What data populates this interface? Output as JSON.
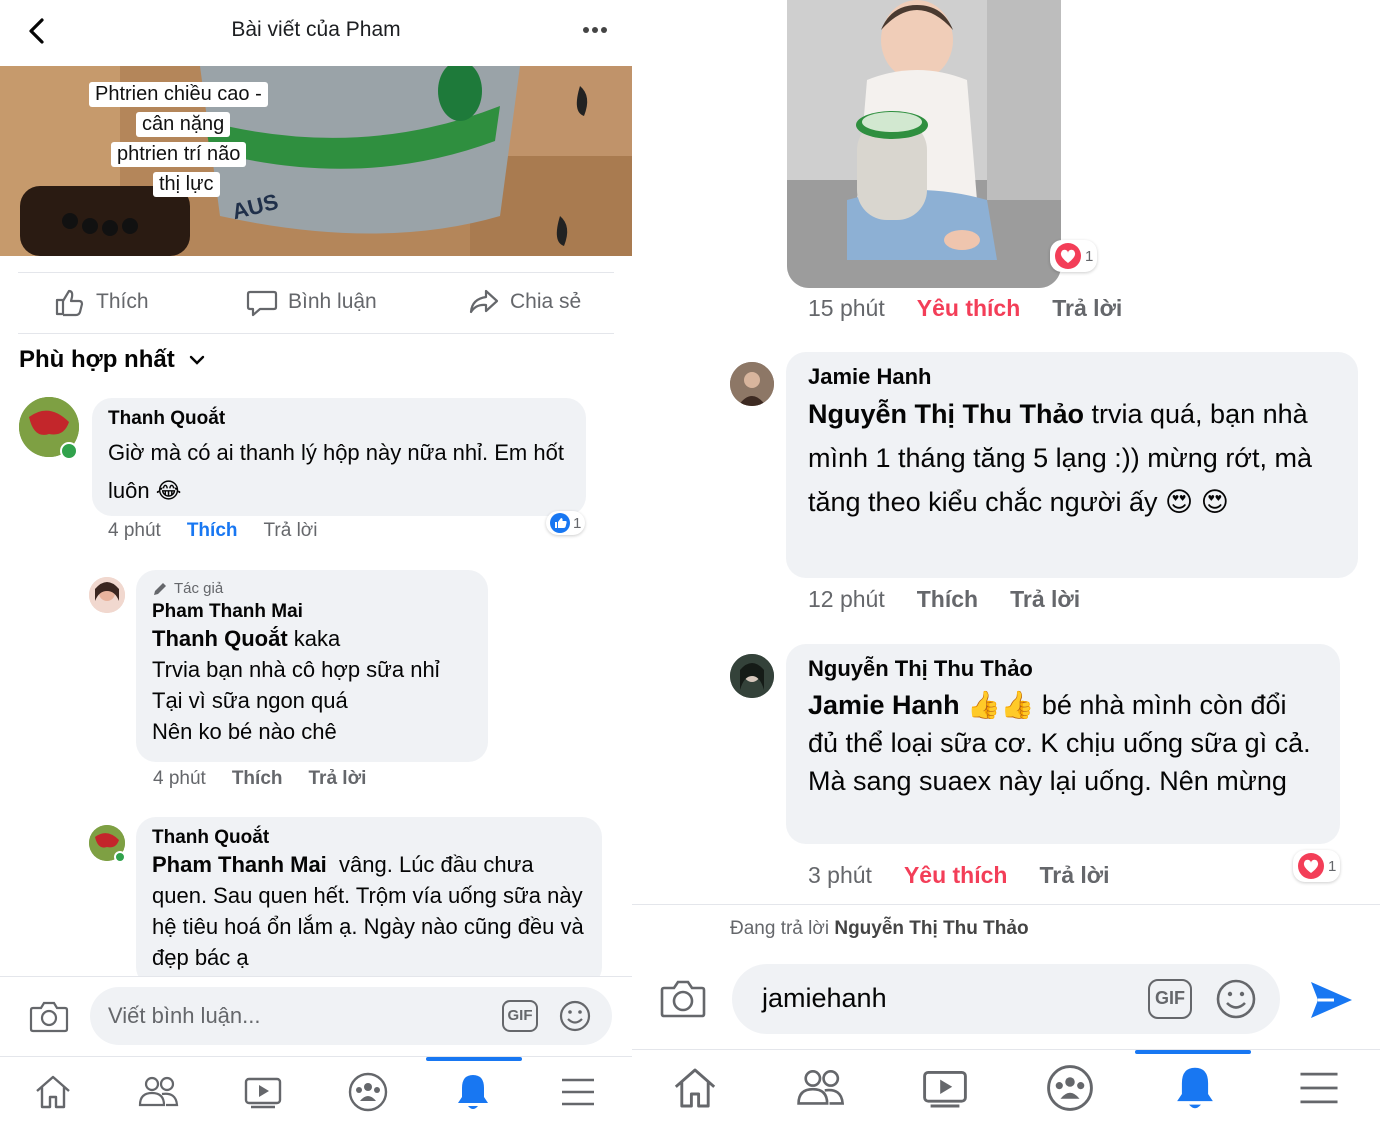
{
  "left": {
    "header": {
      "title": "Bài viết của Pham",
      "back_icon": "chevron-left-icon",
      "more_icon": "more-horizontal-icon"
    },
    "post_image": {
      "labels": [
        "Phtrien chiều cao -",
        "cân nặng",
        "phtrien trí não",
        "thị lực"
      ],
      "product_text": "AUS"
    },
    "actions": {
      "like": "Thích",
      "comment": "Bình luận",
      "share": "Chia sẻ"
    },
    "sort_label": "Phù hợp nhất",
    "comments": [
      {
        "author": "Thanh Quoắt",
        "text": "Giờ mà có ai thanh lý hộp này nữa nhỉ. Em hốt luôn",
        "emoji": "😂",
        "time": "4 phút",
        "like_label": "Thích",
        "reply_label": "Trả lời",
        "reaction_count": "1"
      },
      {
        "author_tag": "Tác giả",
        "author": "Pham Thanh Mai",
        "mention": "Thanh Quoắt",
        "lines": [
          "kaka",
          "Trvia bạn nhà cô hợp sữa nhỉ",
          "Tại vì sữa ngon quá",
          "Nên ko bé nào chê"
        ],
        "time": "4 phút",
        "like_label": "Thích",
        "reply_label": "Trả lời"
      },
      {
        "author": "Thanh Quoắt",
        "mention": "Pham Thanh Mai",
        "text": "vâng. Lúc đầu chưa quen. Sau quen hết. Trộm vía uống sữa này hệ tiêu hoá ổn lắm ạ. Ngày nào cũng đều và đẹp bác ạ"
      }
    ],
    "composer": {
      "placeholder": "Viết bình luận...",
      "gif_label": "GIF"
    }
  },
  "right": {
    "photo_comment": {
      "time": "15 phút",
      "liked_label": "Yêu thích",
      "reply_label": "Trả lời",
      "reaction_count": "1"
    },
    "comments": [
      {
        "author": "Jamie Hanh",
        "mention": "Nguyễn Thị Thu Thảo",
        "text": "trvia quá, bạn nhà mình 1 tháng tăng 5 lạng :)) mừng rớt, mà tăng theo kiểu chắc người ấy",
        "emoji": "😍",
        "emoji2": "😍",
        "time": "12 phút",
        "like_label": "Thích",
        "reply_label": "Trả lời"
      },
      {
        "author": "Nguyễn Thị Thu Thảo",
        "mention": "Jamie Hanh",
        "emoji": "👍👍",
        "text": "bé nhà mình còn đổi đủ thể loại sữa cơ. K chịu uống sữa gì cả. Mà sang suaex này lại uống. Nên mừng",
        "time": "3 phút",
        "liked_label": "Yêu thích",
        "reply_label": "Trả lời",
        "reaction_count": "1"
      }
    ],
    "reply_hint": {
      "prefix": "Đang trả lời",
      "name": "Nguyễn Thị Thu Thảo"
    },
    "composer": {
      "value": "jamiehanh",
      "gif_label": "GIF"
    }
  },
  "nav_icons": [
    "home-icon",
    "friends-icon",
    "watch-icon",
    "groups-icon",
    "notifications-icon",
    "menu-icon"
  ],
  "colors": {
    "accent": "#1877f2",
    "love": "#f33e58",
    "bubble": "#f0f2f5",
    "secondary_text": "#65676b"
  }
}
